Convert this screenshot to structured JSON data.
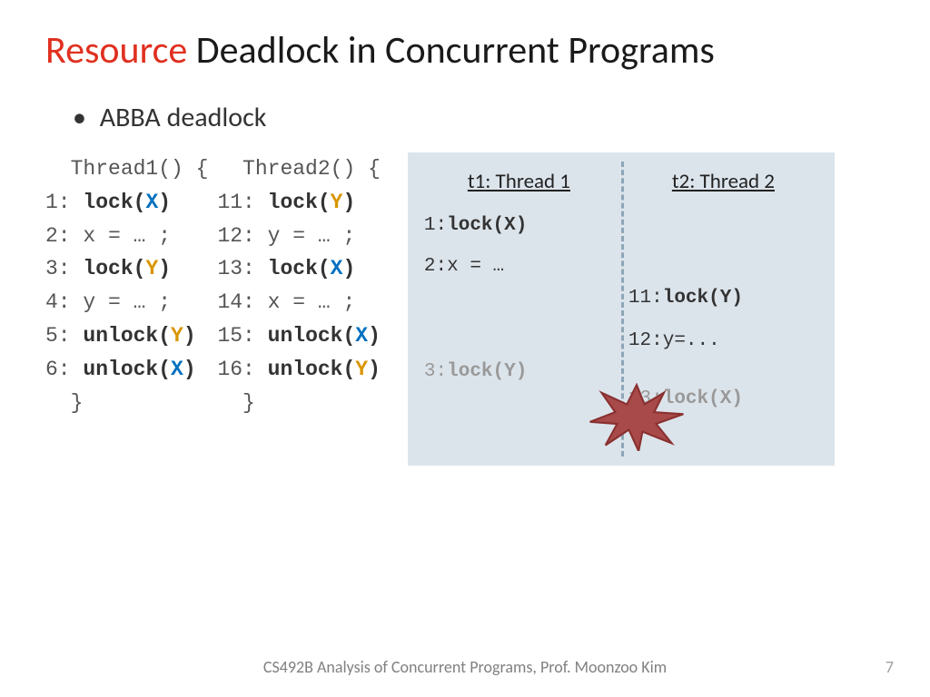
{
  "title": {
    "red": "Resource",
    "rest": " Deadlock in Concurrent Programs"
  },
  "bullet": "ABBA deadlock",
  "thread1": {
    "header": "  Thread1() {",
    "l1a": "1: ",
    "l1b": "lock(",
    "l1v": "X",
    "l1c": ")",
    "l2": "2: x = … ;",
    "l3a": "3: ",
    "l3b": "lock(",
    "l3v": "Y",
    "l3c": ")",
    "l4": "4: y = … ;",
    "l5a": "5: ",
    "l5b": "unlock(",
    "l5v": "Y",
    "l5c": ")",
    "l6a": "6: ",
    "l6b": "unlock(",
    "l6v": "X",
    "l6c": ")",
    "close": "  }"
  },
  "thread2": {
    "header": "  Thread2() {",
    "l1a": "11: ",
    "l1b": "lock(",
    "l1v": "Y",
    "l1c": ")",
    "l2": "12: y = … ;",
    "l3a": "13: ",
    "l3b": "lock(",
    "l3v": "X",
    "l3c": ")",
    "l4": "14: x = … ;",
    "l5a": "15: ",
    "l5b": "unlock(",
    "l5v": "X",
    "l5c": ")",
    "l6a": "16: ",
    "l6b": "unlock(",
    "l6v": "Y",
    "l6c": ")",
    "close": "  }"
  },
  "diagram": {
    "h1": "t1: Thread 1",
    "h2": "t2: Thread 2",
    "t1l1a": "1:",
    "t1l1b": "lock(X)",
    "t1l2": "2:x = …",
    "t1l3a": "3:",
    "t1l3b": "lock(Y)",
    "t2l1a": "11:",
    "t2l1b": "lock(Y)",
    "t2l2": "12:y=...",
    "t2l3a": "13:",
    "t2l3b": "lock(X)"
  },
  "footer": "CS492B Analysis of Concurrent Programs, Prof. Moonzoo Kim",
  "page": "7"
}
